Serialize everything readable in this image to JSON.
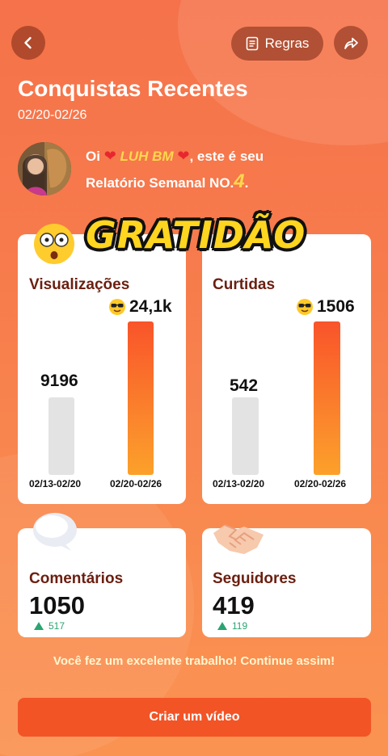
{
  "header": {
    "back_icon": "chevron-left-icon",
    "rules_label": "Regras",
    "rules_icon": "document-icon",
    "share_icon": "share-icon"
  },
  "page": {
    "title": "Conquistas Recentes",
    "date_range": "02/20-02/26"
  },
  "greeting": {
    "prefix": "Oi",
    "name": "LUH BM",
    "suffix": ", este é seu",
    "line2": "Relatório Semanal NO.",
    "report_number": "4",
    "line2_end": "."
  },
  "overlay": {
    "text": "GRATIDÃO",
    "emoji_icon": "surprised-face-icon"
  },
  "views_card": {
    "title": "Visualizações",
    "current_value_label": "24,1k",
    "previous_value_label": "9196",
    "current_badge_icon": "sunglasses-face-icon",
    "prev_period": "02/13-02/20",
    "curr_period": "02/20-02/26",
    "previous": 9196,
    "current": 24100
  },
  "likes_card": {
    "title": "Curtidas",
    "current_value_label": "1506",
    "previous_value_label": "542",
    "current_badge_icon": "sunglasses-face-icon",
    "prev_period": "02/13-02/20",
    "curr_period": "02/20-02/26",
    "previous": 542,
    "current": 1506
  },
  "comments_card": {
    "title": "Comentários",
    "value": "1050",
    "delta": "517",
    "icon": "speech-bubble-icon"
  },
  "followers_card": {
    "title": "Seguidores",
    "value": "419",
    "delta": "119",
    "icon": "handshake-icon"
  },
  "footer": {
    "message": "Você fez um excelente trabalho! Continue assim!",
    "cta_label": "Criar um vídeo"
  },
  "colors": {
    "accent": "#f25426",
    "title_brown": "#6b1f10",
    "positive": "#2aa572",
    "highlight": "#ffd84d"
  }
}
